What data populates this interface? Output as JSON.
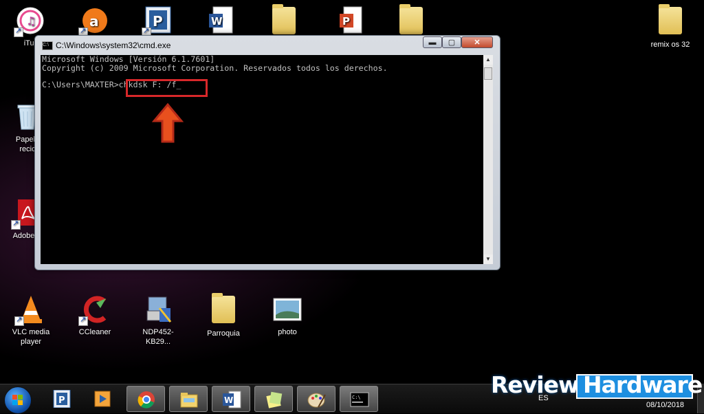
{
  "desktop": {
    "icons": [
      {
        "name": "itunes",
        "label": "iTur"
      },
      {
        "name": "papelera",
        "label": "Papele\nrecic"
      },
      {
        "name": "adobe",
        "label": "Adobe R"
      },
      {
        "name": "remix",
        "label": "remix os 32"
      },
      {
        "name": "vlc",
        "label": "VLC media player"
      },
      {
        "name": "ccleaner",
        "label": "CCleaner"
      },
      {
        "name": "ndp",
        "label": "NDP452-KB29..."
      },
      {
        "name": "parroquia",
        "label": "Parroquia"
      },
      {
        "name": "photo",
        "label": "photo"
      }
    ]
  },
  "cmd": {
    "title": "C:\\Windows\\system32\\cmd.exe",
    "title_icon_text": "C:\\",
    "buttons": {
      "minimize": "▬",
      "maximize": "▢",
      "close": "✕"
    },
    "lines": [
      "Microsoft Windows [Versión 6.1.7601]",
      "Copyright (c) 2009 Microsoft Corporation. Reservados todos los derechos.",
      "",
      "C:\\Users\\MAXTER>chkdsk F: /f_"
    ],
    "command": "chkdsk F: /f"
  },
  "annotation": {
    "highlight_color": "#d8282a",
    "arrow_color": "#e8501e"
  },
  "taskbar": {
    "items": [
      "start",
      "teamviewer",
      "media-player",
      "chrome",
      "explorer",
      "word",
      "sticky-notes",
      "paint",
      "cmd"
    ],
    "active": "cmd",
    "language": "ES",
    "date": "08/10/2018"
  },
  "watermark": {
    "review": "Review",
    "hardware": "Hardware",
    "brand_color": "#1e8fe0"
  }
}
